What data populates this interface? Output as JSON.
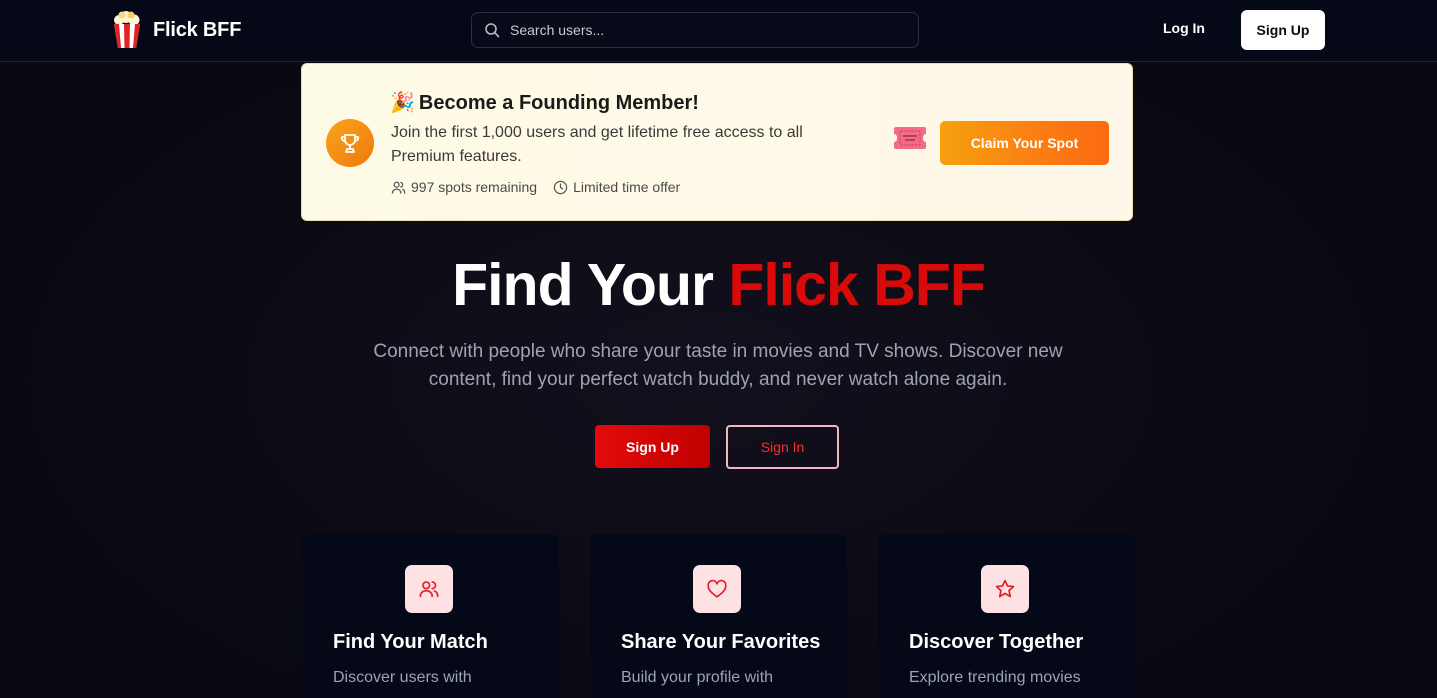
{
  "nav": {
    "brand": "Flick BFF",
    "search_placeholder": "Search users...",
    "login_label": "Log In",
    "signup_label": "Sign Up"
  },
  "banner": {
    "title": "Become a Founding Member!",
    "description": "Join the first 1,000 users and get lifetime free access to all Premium features.",
    "spots_remaining": "997 spots remaining",
    "offer_note": "Limited time offer",
    "cta_label": "Claim Your Spot"
  },
  "hero": {
    "title_part1": "Find Your",
    "title_part2": "Flick BFF",
    "subtitle": "Connect with people who share your taste in movies and TV shows. Discover new content, find your perfect watch buddy, and never watch alone again.",
    "signup_label": "Sign Up",
    "signin_label": "Sign In"
  },
  "features": [
    {
      "title": "Find Your Match",
      "description": "Discover users with",
      "icon": "users-icon"
    },
    {
      "title": "Share Your Favorites",
      "description": "Build your profile with",
      "icon": "heart-icon"
    },
    {
      "title": "Discover Together",
      "description": "Explore trending movies",
      "icon": "star-icon"
    }
  ],
  "colors": {
    "accent_red": "#d90a0a",
    "banner_orange": "#fb7f12",
    "background": "#0a0a14"
  }
}
